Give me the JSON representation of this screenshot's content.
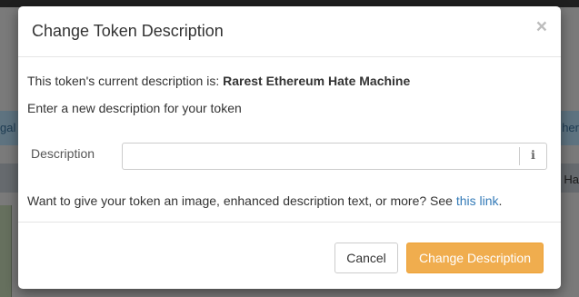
{
  "background": {
    "left_text": "gal",
    "right_text": "her",
    "right_text2": "Ha"
  },
  "modal": {
    "title": "Change Token Description",
    "close_glyph": "×",
    "current_prefix": "This token's current description is: ",
    "current_value": "Rarest Ethereum Hate Machine",
    "instruction": "Enter a new description for your token",
    "description_label": "Description",
    "description_value": "",
    "info_icon": "ℹ",
    "more_prefix": "Want to give your token an image, enhanced description text, or more? See ",
    "more_link": "this link",
    "more_suffix": ".",
    "cancel_label": "Cancel",
    "submit_label": "Change Description"
  },
  "colors": {
    "link": "#337ab7",
    "primary_button": "#f0ad4e",
    "overlay": "#6f6f6f"
  }
}
